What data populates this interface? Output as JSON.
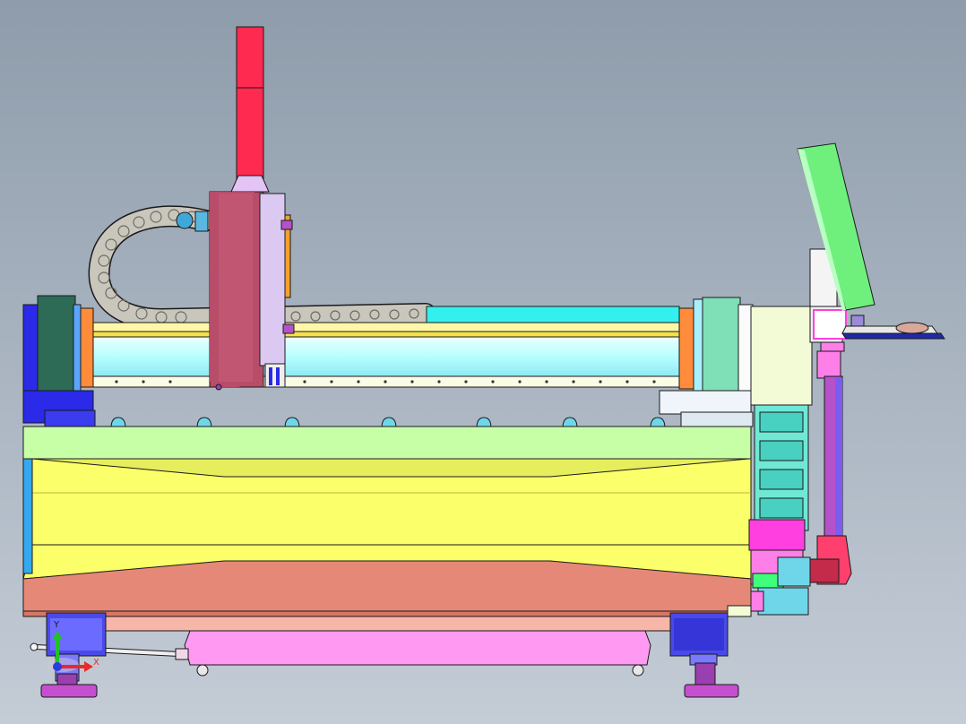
{
  "viewport": {
    "background_top": "#8e9cab",
    "background_bottom": "#c4ccd6"
  },
  "model": {
    "part_colors": {
      "z_axis_column": "#ff2a4f",
      "carriage": "#b84d6a",
      "carriage_plate": "#dcc9f2",
      "cable_chain": "#c9c6bc",
      "beam_rail": "#b7ffff",
      "beam_cover": "#33f0ee",
      "left_end_block": "#2e6b57",
      "left_base": "#2a2ae8",
      "right_end_block": "#7fe0b8",
      "right_housing": "#f3fbd6",
      "bed_top": "#c6ffa6",
      "bed_body": "#fbff6a",
      "bed_bottom": "#e68878",
      "frame_rail": "#f7b6a8",
      "chip_tray": "#ff99f2",
      "leg_block": "#4a4ae8",
      "foot": "#c54fcf",
      "control_panel": "#6ff07c",
      "panel_post": "#b452c9",
      "pipe_elbow": "#ff3f6e",
      "drag_chain_vertical": "#6fe8d6",
      "motor": "#6fd6ea"
    }
  },
  "triad": {
    "y_label": "Y",
    "x_label": "X",
    "y_color": "#22c12a",
    "x_color": "#e82a2a",
    "z_color": "#2a3be0"
  }
}
